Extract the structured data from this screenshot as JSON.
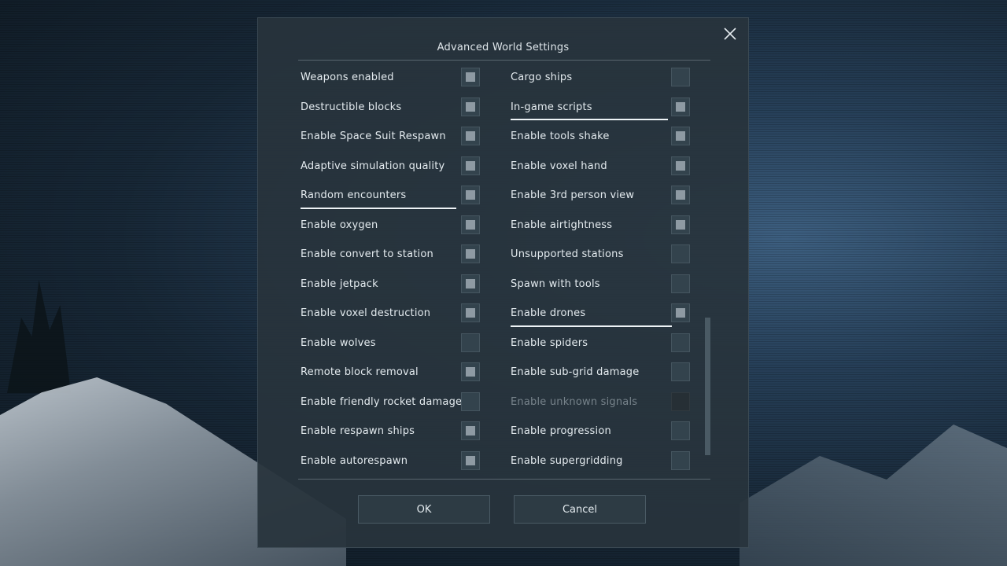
{
  "dialog": {
    "title": "Advanced World Settings",
    "close_icon": "close-icon"
  },
  "left_settings": [
    {
      "label": "Weapons enabled",
      "checked": true
    },
    {
      "label": "Destructible blocks",
      "checked": true
    },
    {
      "label": "Enable Space Suit Respawn",
      "checked": true
    },
    {
      "label": "Adaptive simulation quality",
      "checked": true
    },
    {
      "label": "Random encounters",
      "checked": true,
      "focused": true
    },
    {
      "label": "Enable oxygen",
      "checked": true
    },
    {
      "label": "Enable convert to station",
      "checked": true
    },
    {
      "label": "Enable jetpack",
      "checked": true
    },
    {
      "label": "Enable voxel destruction",
      "checked": true
    },
    {
      "label": "Enable wolves",
      "checked": false
    },
    {
      "label": "Remote block removal",
      "checked": true
    },
    {
      "label": "Enable friendly rocket damage",
      "checked": false
    },
    {
      "label": "Enable respawn ships",
      "checked": true
    },
    {
      "label": "Enable autorespawn",
      "checked": true
    }
  ],
  "right_settings": [
    {
      "label": "Cargo ships",
      "checked": false
    },
    {
      "label": "In-game scripts",
      "checked": true,
      "focused": true
    },
    {
      "label": "Enable tools shake",
      "checked": true
    },
    {
      "label": "Enable voxel hand",
      "checked": true
    },
    {
      "label": "Enable 3rd person view",
      "checked": true
    },
    {
      "label": "Enable airtightness",
      "checked": true
    },
    {
      "label": "Unsupported stations",
      "checked": false
    },
    {
      "label": "Spawn with tools",
      "checked": false
    },
    {
      "label": "Enable drones",
      "checked": true,
      "focused": true
    },
    {
      "label": "Enable spiders",
      "checked": false
    },
    {
      "label": "Enable sub-grid damage",
      "checked": false
    },
    {
      "label": "Enable unknown signals",
      "checked": false,
      "disabled": true
    },
    {
      "label": "Enable progression",
      "checked": false
    },
    {
      "label": "Enable supergridding",
      "checked": false
    }
  ],
  "buttons": {
    "ok": "OK",
    "cancel": "Cancel"
  },
  "colors": {
    "checkbox_fill": "#8e9aa3",
    "label_text": "#e4ebef",
    "disabled_text": "#77838b",
    "dialog_bg": "#28343c"
  }
}
